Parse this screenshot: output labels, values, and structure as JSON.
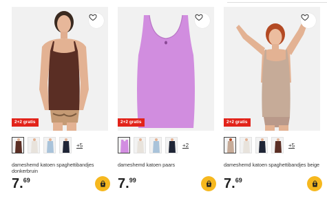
{
  "products": [
    {
      "promo": "2+2 gratis",
      "title": "dameshemd katoen spaghettibandjes donkerbruin",
      "price_main": "7",
      "price_cents": "69",
      "more_colors": "+5",
      "swatch_colors": [
        "#5a2e24",
        "#e8e3dc",
        "#a9c3da",
        "#1f2536"
      ]
    },
    {
      "promo": "2+2 gratis",
      "title": "dameshemd katoen paars",
      "price_main": "7",
      "price_cents": "99",
      "more_colors": "+2",
      "swatch_colors": [
        "#d28de1",
        "#e8e3dc",
        "#a9c3da",
        "#1f2536"
      ]
    },
    {
      "promo": "2+2 gratis",
      "title": "dameshemd katoen spaghettibandjes beige",
      "price_main": "7",
      "price_cents": "69",
      "more_colors": "+5",
      "swatch_colors": [
        "#c6ab98",
        "#e8e3dc",
        "#1f2536",
        "#5a2e24"
      ]
    }
  ],
  "colors": {
    "promo_red": "#e2231a",
    "cart_yellow": "#f6b81f",
    "image_bg": "#f1f1f1"
  },
  "icons": {
    "favorite": "heart-icon",
    "cart": "shopping-bag-icon"
  }
}
